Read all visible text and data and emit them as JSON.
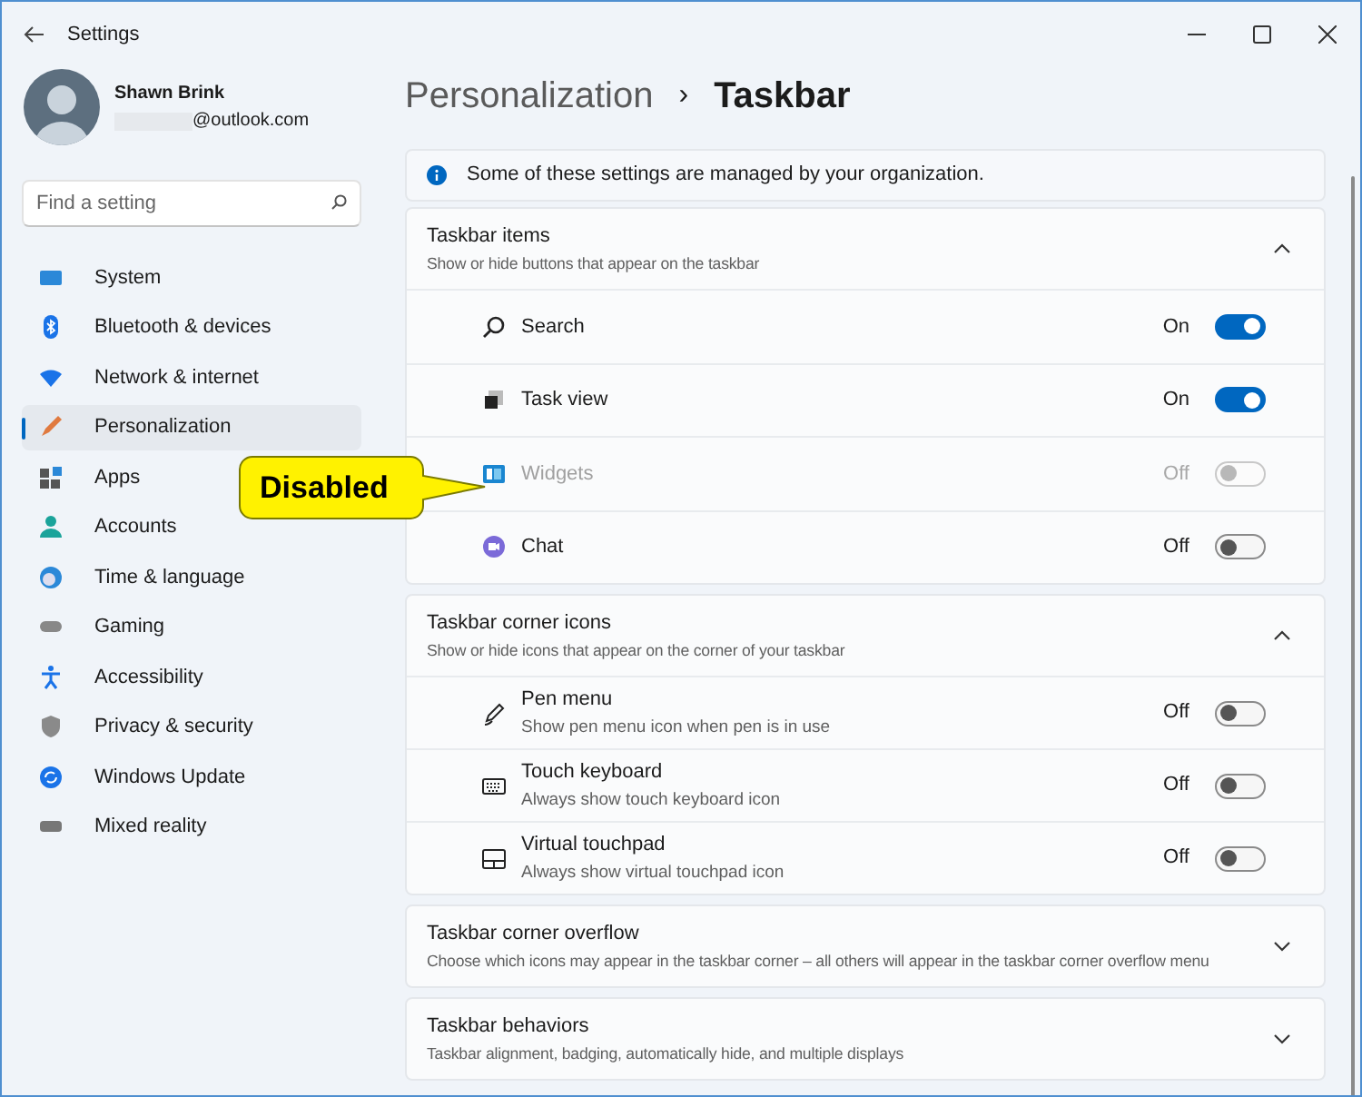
{
  "window": {
    "title": "Settings"
  },
  "profile": {
    "name": "Shawn Brink",
    "email": "@outlook.com"
  },
  "search": {
    "placeholder": "Find a setting"
  },
  "sidebar": {
    "items": [
      {
        "label": "System",
        "selected": false
      },
      {
        "label": "Bluetooth & devices",
        "selected": false
      },
      {
        "label": "Network & internet",
        "selected": false
      },
      {
        "label": "Personalization",
        "selected": true
      },
      {
        "label": "Apps",
        "selected": false
      },
      {
        "label": "Accounts",
        "selected": false
      },
      {
        "label": "Time & language",
        "selected": false
      },
      {
        "label": "Gaming",
        "selected": false
      },
      {
        "label": "Accessibility",
        "selected": false
      },
      {
        "label": "Privacy & security",
        "selected": false
      },
      {
        "label": "Windows Update",
        "selected": false
      },
      {
        "label": "Mixed reality",
        "selected": false
      }
    ]
  },
  "breadcrumb": {
    "parent": "Personalization",
    "separator": "›",
    "current": "Taskbar"
  },
  "notice": {
    "text": "Some of these settings are managed by your organization."
  },
  "sections": [
    {
      "title": "Taskbar items",
      "subtitle": "Show or hide buttons that appear on the taskbar",
      "expanded": true,
      "items": [
        {
          "label": "Search",
          "on": true,
          "disabled": false,
          "state_label": "On"
        },
        {
          "label": "Task view",
          "on": true,
          "disabled": false,
          "state_label": "On"
        },
        {
          "label": "Widgets",
          "on": false,
          "disabled": true,
          "state_label": "Off"
        },
        {
          "label": "Chat",
          "on": false,
          "disabled": false,
          "state_label": "Off"
        }
      ]
    },
    {
      "title": "Taskbar corner icons",
      "subtitle": "Show or hide icons that appear on the corner of your taskbar",
      "expanded": true,
      "items": [
        {
          "label": "Pen menu",
          "description": "Show pen menu icon when pen is in use",
          "on": false,
          "disabled": false,
          "state_label": "Off"
        },
        {
          "label": "Touch keyboard",
          "description": "Always show touch keyboard icon",
          "on": false,
          "disabled": false,
          "state_label": "Off"
        },
        {
          "label": "Virtual touchpad",
          "description": "Always show virtual touchpad icon",
          "on": false,
          "disabled": false,
          "state_label": "Off"
        }
      ]
    },
    {
      "title": "Taskbar corner overflow",
      "subtitle": "Choose which icons may appear in the taskbar corner – all others will appear in the taskbar corner overflow menu",
      "expanded": false
    },
    {
      "title": "Taskbar behaviors",
      "subtitle": "Taskbar alignment, badging, automatically hide, and multiple displays",
      "expanded": false
    }
  ],
  "callout": {
    "text": "Disabled"
  }
}
